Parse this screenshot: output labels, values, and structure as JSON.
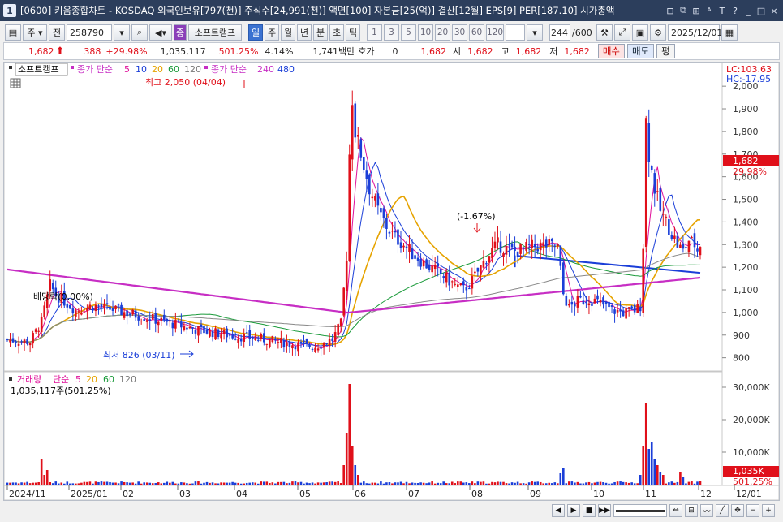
{
  "window": {
    "badge": "1",
    "title": "[0600] 키움종합차트 - KOSDAQ 외국인보유[797(천)] 주식수[24,991(천)] 액면[100] 자본금[25(억)] 결산[12월] EPS[9] PER[187.10] 시가총액",
    "buttons": [
      "⊟",
      "⧉",
      "⊞",
      "ᴬ",
      "T",
      "?",
      "_",
      "□",
      "×"
    ]
  },
  "toolbar": {
    "period_sel": "주",
    "type_sel": "전",
    "code": "258790",
    "sector_badge": "종",
    "stock_name": "소프트캠프",
    "periods": [
      "일",
      "주",
      "월",
      "년",
      "분",
      "초",
      "틱"
    ],
    "active_period": "일",
    "intervals": [
      "1",
      "3",
      "5",
      "10",
      "20",
      "30",
      "60",
      "120"
    ],
    "count": "244",
    "count_max": "/600",
    "date": "2025/12/01"
  },
  "quote": {
    "price": "1,682",
    "change": "388",
    "change_pct": "+29.98%",
    "volume": "1,035,117",
    "vol_ratio": "501.25%",
    "turnover": "4.14%",
    "amount": "1,741백만",
    "hoga_label": "호가",
    "hoga": "0",
    "ask": "1,682",
    "open_label": "시",
    "open": "1,682",
    "high_label": "고",
    "high": "1,682",
    "low_label": "저",
    "low": "1,682",
    "buy": "매수",
    "sell": "매도",
    "flat": "평"
  },
  "chart_data": {
    "type": "candlestick",
    "price_legend": {
      "name": "소프트캠프",
      "ma_label": "종가 단순",
      "ma_short": [
        {
          "period": "5",
          "color": "#e0109a"
        },
        {
          "period": "10",
          "color": "#1a3ed8"
        },
        {
          "period": "20",
          "color": "#e6a300"
        },
        {
          "period": "60",
          "color": "#1a9a3a"
        },
        {
          "period": "120",
          "color": "#777777"
        }
      ],
      "ma_label2": "종가 단순",
      "ma_long": [
        {
          "period": "240",
          "color": "#c72ec4"
        },
        {
          "period": "480",
          "color": "#1a3ed8"
        }
      ]
    },
    "lc": "LC:103.63",
    "hc": "HC:-17.95",
    "y_ticks": [
      2000,
      1900,
      1800,
      1700,
      1600,
      1500,
      1400,
      1300,
      1200,
      1100,
      1000,
      900,
      800
    ],
    "ylim": [
      770,
      2040
    ],
    "last_price_label": "1,682",
    "last_pct_label": "29.98%",
    "annotations": {
      "high": "최고 2,050 (04/04)",
      "low": "최저 826 (03/11)",
      "mid": "(-1.67%)",
      "left": "배당락(0.00%)"
    },
    "x_labels": [
      "2024/11",
      "2025/01",
      "02",
      "03",
      "04",
      "05",
      "06",
      "07",
      "08",
      "09",
      "10",
      "11",
      "12",
      "12/01"
    ],
    "volume_legend": {
      "name": "거래량",
      "ma_label": "단순",
      "periods": [
        {
          "period": "5",
          "color": "#e0109a"
        },
        {
          "period": "20",
          "color": "#e6a300"
        },
        {
          "period": "60",
          "color": "#1a9a3a"
        },
        {
          "period": "120",
          "color": "#777777"
        }
      ],
      "current": "1,035,117주(501.25%)"
    },
    "vol_ticks": [
      "30,000K",
      "20,000K",
      "10,000K"
    ],
    "vol_ticks_values": [
      30000,
      20000,
      10000
    ],
    "vol_max": 33500,
    "vol_last_label": "1,035K",
    "vol_last_pct": "501.25%",
    "colors": {
      "up": "#e0101a",
      "down": "#1a3ed8",
      "ma5": "#e0109a",
      "ma10": "#1a3ed8",
      "ma20": "#e6a300",
      "ma60": "#1a9a3a",
      "ma120": "#888888",
      "ma240": "#c72ec4",
      "trend": "#1a3ed8"
    }
  }
}
